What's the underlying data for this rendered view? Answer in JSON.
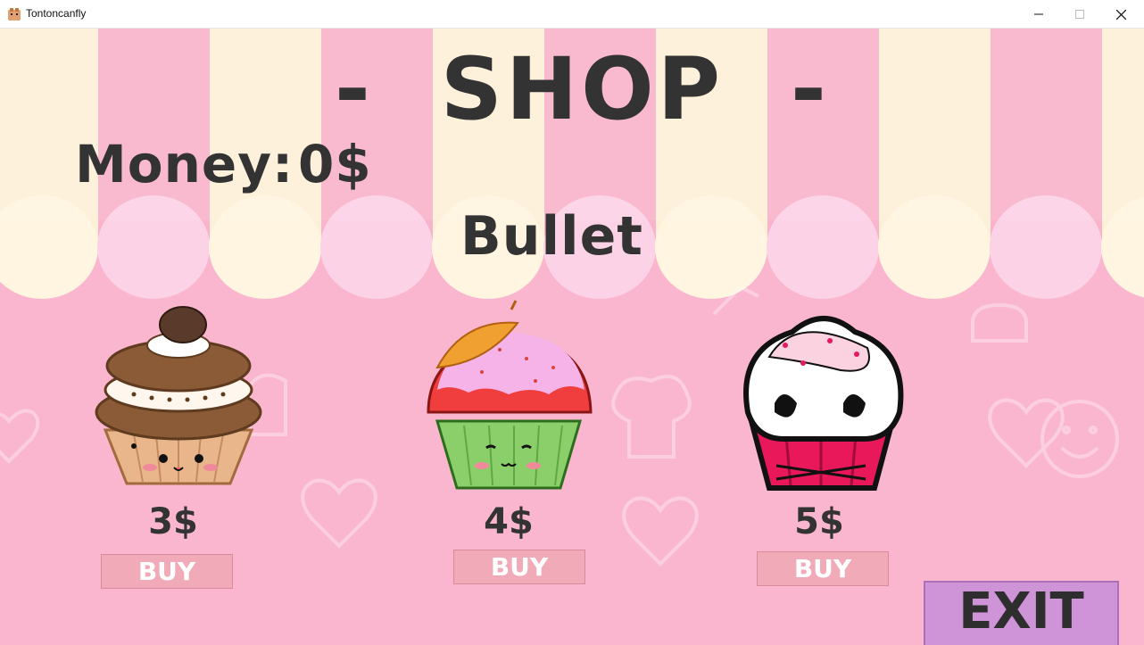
{
  "window": {
    "title": "Tontoncanfly"
  },
  "shop": {
    "title": "-  SHOP  -",
    "money_label": "Money:",
    "money_value": "0$",
    "section_title": "Bullet"
  },
  "items": [
    {
      "price": "3$",
      "buy_label": "BUY"
    },
    {
      "price": "4$",
      "buy_label": "BUY"
    },
    {
      "price": "5$",
      "buy_label": "BUY"
    }
  ],
  "exit_label": "EXIT",
  "colors": {
    "awning_pink": "#f9b3cb",
    "awning_cream": "#fdf0d8",
    "background_pink": "#fbb6cf",
    "buy_button": "#f0aab8",
    "exit_button": "#cf94d8",
    "text_dark": "#333333"
  }
}
